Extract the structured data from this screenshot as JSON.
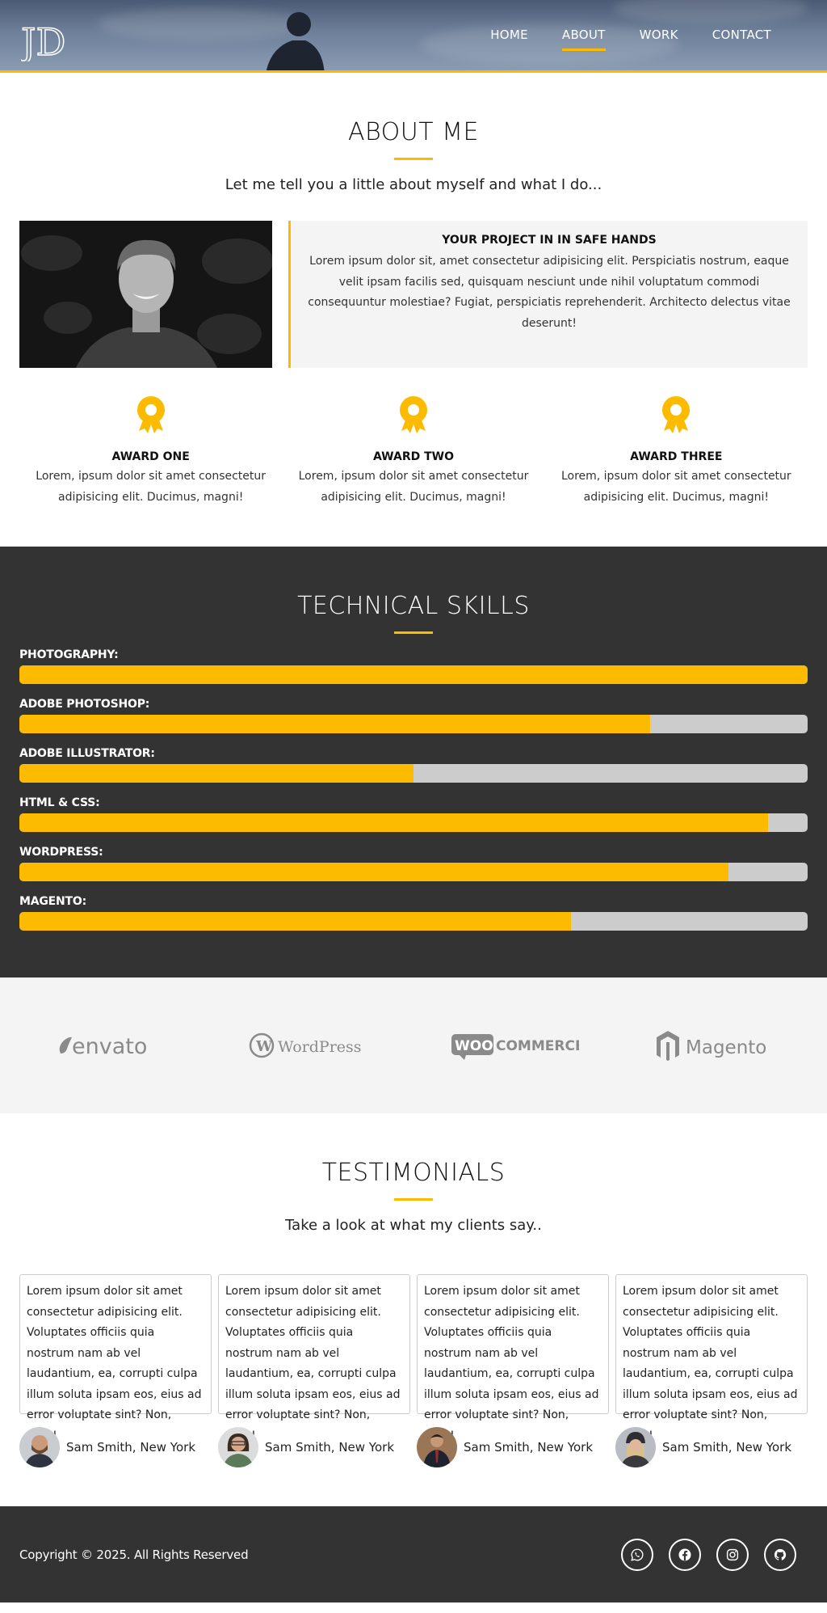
{
  "header": {
    "logo_text": "JD",
    "nav": [
      {
        "label": "HOME",
        "active": false
      },
      {
        "label": "ABOUT",
        "active": true
      },
      {
        "label": "WORK",
        "active": false
      },
      {
        "label": "CONTACT",
        "active": false
      }
    ]
  },
  "about": {
    "title": "ABOUT ME",
    "subtitle": "Let me tell you a little about myself and what I do...",
    "box_title": "YOUR PROJECT IN IN SAFE HANDS",
    "box_text": "Lorem ipsum dolor sit, amet consectetur adipisicing elit. Perspiciatis nostrum, eaque velit ipsam facilis sed, quisquam nesciunt unde nihil voluptatum commodi consequuntur molestiae? Fugiat, perspiciatis reprehenderit. Architecto delectus vitae deserunt!",
    "awards": [
      {
        "title": "AWARD ONE",
        "text": "Lorem, ipsum dolor sit amet consectetur adipisicing elit. Ducimus, magni!"
      },
      {
        "title": "AWARD TWO",
        "text": "Lorem, ipsum dolor sit amet consectetur adipisicing elit. Ducimus, magni!"
      },
      {
        "title": "AWARD THREE",
        "text": "Lorem, ipsum dolor sit amet consectetur adipisicing elit. Ducimus, magni!"
      }
    ]
  },
  "skills": {
    "title": "TECHNICAL SKILLS",
    "items": [
      {
        "label": "PHOTOGRAPHY:",
        "level": 100
      },
      {
        "label": "ADOBE PHOTOSHOP:",
        "level": 80
      },
      {
        "label": "ADOBE ILLUSTRATOR:",
        "level": 50
      },
      {
        "label": "HTML & CSS:",
        "level": 95
      },
      {
        "label": "WORDPRESS:",
        "level": 90
      },
      {
        "label": "MAGENTO:",
        "level": 70
      }
    ]
  },
  "brands": [
    "envato",
    "WordPress",
    "WooCommerce",
    "Magento"
  ],
  "testimonials": {
    "title": "TESTIMONIALS",
    "subtitle": "Take a look at what my clients say..",
    "items": [
      {
        "text": "Lorem ipsum dolor sit amet consectetur adipisicing elit. Voluptates officiis quia nostrum nam ab vel laudantium, ea, corrupti culpa illum soluta ipsam eos, eius ad error voluptate sint? Non, fugit!",
        "author": "Sam Smith, New York"
      },
      {
        "text": "Lorem ipsum dolor sit amet consectetur adipisicing elit. Voluptates officiis quia nostrum nam ab vel laudantium, ea, corrupti culpa illum soluta ipsam eos, eius ad error voluptate sint? Non, fugit!",
        "author": "Sam Smith, New York"
      },
      {
        "text": "Lorem ipsum dolor sit amet consectetur adipisicing elit. Voluptates officiis quia nostrum nam ab vel laudantium, ea, corrupti culpa illum soluta ipsam eos, eius ad error voluptate sint? Non, fugit!",
        "author": "Sam Smith, New York"
      },
      {
        "text": "Lorem ipsum dolor sit amet consectetur adipisicing elit. Voluptates officiis quia nostrum nam ab vel laudantium, ea, corrupti culpa illum soluta ipsam eos, eius ad error voluptate sint? Non, fugit!",
        "author": "Sam Smith, New York"
      }
    ]
  },
  "footer": {
    "copyright": "Copyright © 2025. All Rights Reserved",
    "socials": [
      "whatsapp-icon",
      "facebook-icon",
      "instagram-icon",
      "github-icon"
    ]
  },
  "colors": {
    "accent": "#fdbb00",
    "dark": "#333333",
    "light": "#f4f4f4"
  }
}
